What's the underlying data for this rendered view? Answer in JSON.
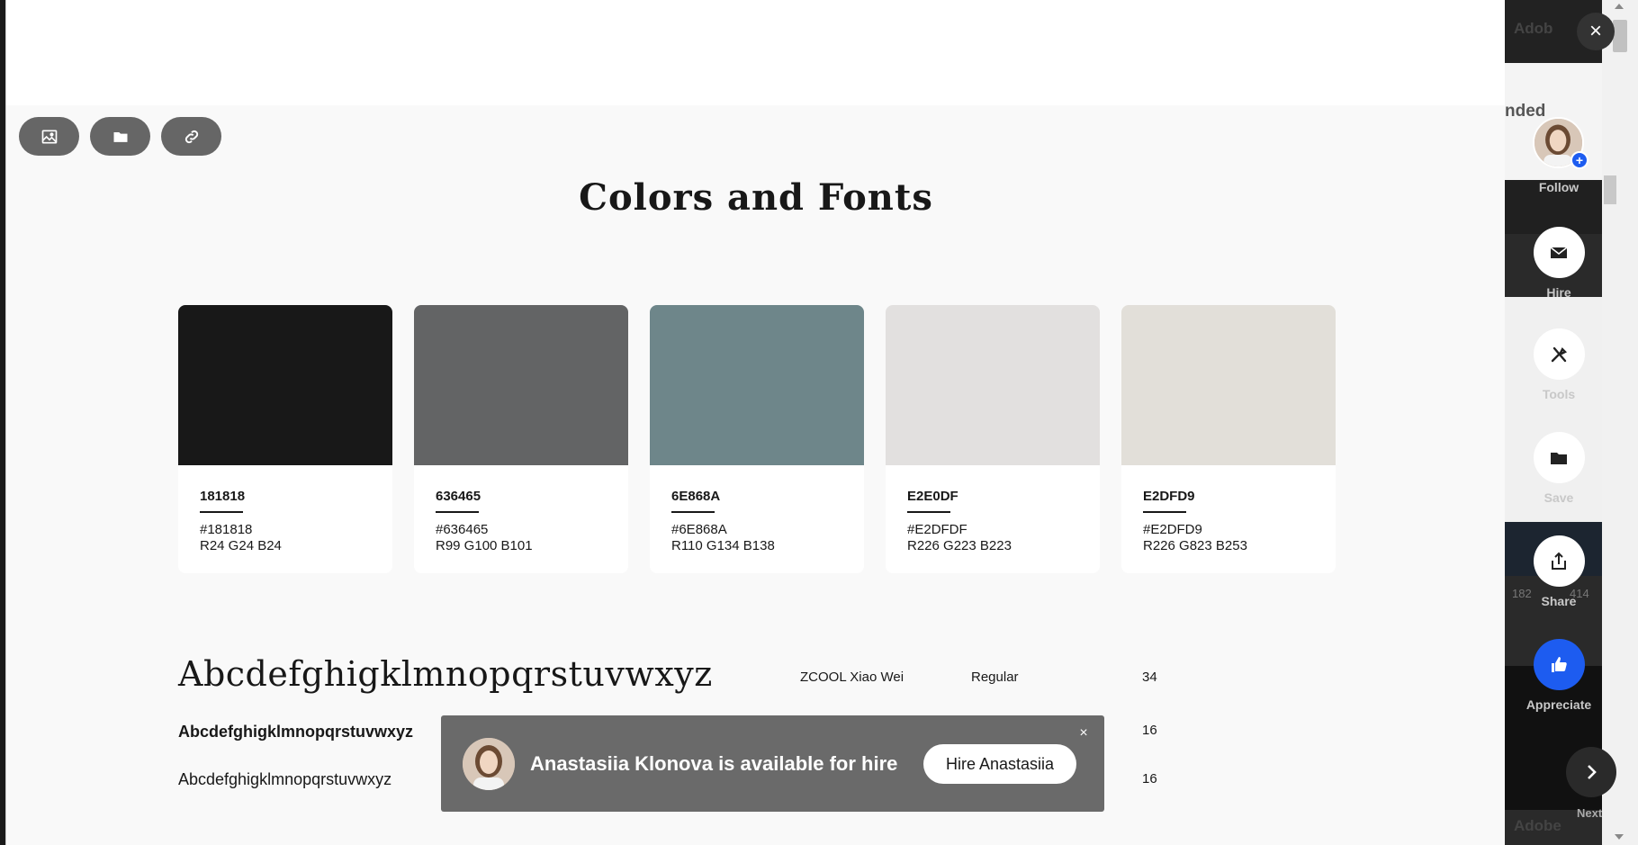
{
  "background_page": {
    "top_text": "Adob",
    "mid_text": "nded",
    "counts": [
      "182",
      "414"
    ],
    "bottom_text": "Adobe"
  },
  "toolbar": {
    "image_icon": "image-icon",
    "folder_icon": "folder-icon",
    "link_icon": "link-icon"
  },
  "section": {
    "title": "Colors and Fonts"
  },
  "swatches": [
    {
      "code": "181818",
      "hex": "#181818",
      "rgb": "R24 G24 B24",
      "color": "#181818"
    },
    {
      "code": "636465",
      "hex": "#636465",
      "rgb": "R99 G100 B101",
      "color": "#636465"
    },
    {
      "code": "6E868A",
      "hex": "#6E868A",
      "rgb": "R110 G134 B138",
      "color": "#6E868A"
    },
    {
      "code": "E2E0DF",
      "hex": "#E2DFDF",
      "rgb": "R226 G223 B223",
      "color": "#E2E0DF"
    },
    {
      "code": "E2DFD9",
      "hex": "#E2DFD9",
      "rgb": "R226 G823 B253",
      "color": "#E2DFD9"
    }
  ],
  "fonts": [
    {
      "sample": "Abcdefghigklmnopqrstuvwxyz",
      "name": "ZCOOL Xiao Wei",
      "weight": "Regular",
      "size": "34"
    },
    {
      "sample": "Abcdefghigklmnopqrstuvwxyz",
      "name": "",
      "weight": "",
      "size": "16"
    },
    {
      "sample": "Abcdefghigklmnopqrstuvwxyz",
      "name": "",
      "weight": "",
      "size": "16"
    }
  ],
  "hire_banner": {
    "text": "Anastasiia Klonova is available for hire",
    "button": "Hire Anastasiia",
    "close": "×"
  },
  "rail": {
    "follow": "Follow",
    "hire": "Hire",
    "tools": "Tools",
    "save": "Save",
    "share": "Share",
    "appreciate": "Appreciate",
    "next": "Next",
    "close": "×"
  },
  "colors": {
    "accent": "#1d5cf0",
    "banner": "#6a6a6a"
  }
}
